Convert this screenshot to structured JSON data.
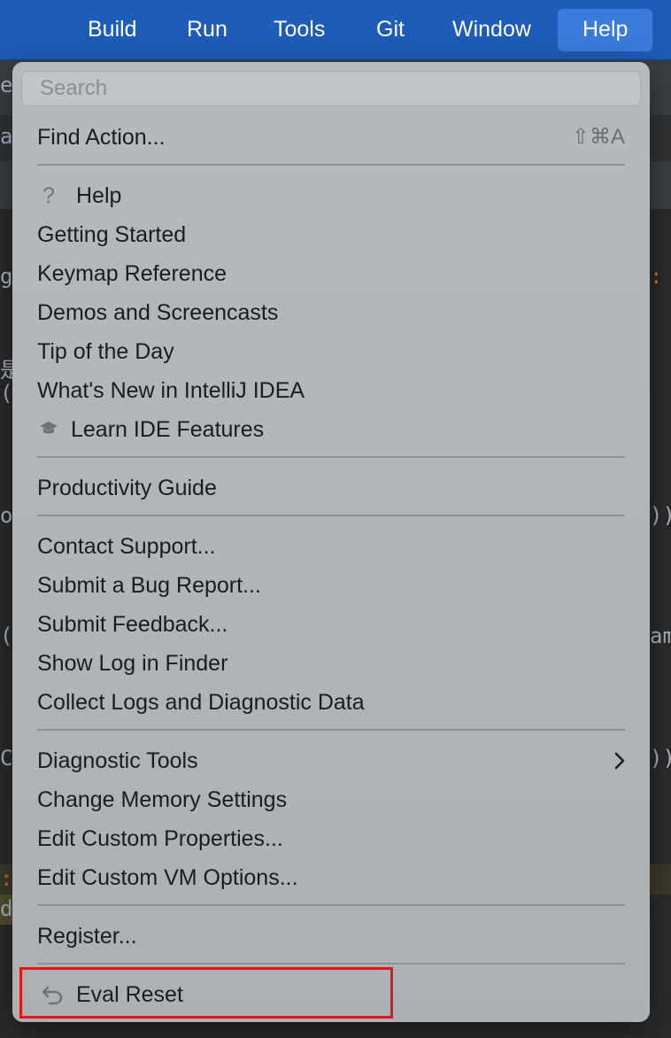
{
  "menubar": {
    "items": [
      "Build",
      "Run",
      "Tools",
      "Git",
      "Window",
      "Help"
    ],
    "active": "Help"
  },
  "background_code": {
    "fragments": [
      "ea",
      "a",
      "ge",
      ":",
      "是",
      "()",
      "or",
      "))",
      "(D",
      "am",
      "Co",
      "))",
      ":",
      "du"
    ]
  },
  "help_menu": {
    "search_placeholder": "Search",
    "find_action": {
      "label": "Find Action...",
      "shortcut": "⇧⌘A"
    },
    "help": "Help",
    "getting_started": "Getting Started",
    "keymap_reference": "Keymap Reference",
    "demos": "Demos and Screencasts",
    "tip_of_day": "Tip of the Day",
    "whats_new": "What's New in IntelliJ IDEA",
    "learn_ide": "Learn IDE Features",
    "productivity_guide": "Productivity Guide",
    "contact_support": "Contact Support...",
    "submit_bug": "Submit a Bug Report...",
    "submit_feedback": "Submit Feedback...",
    "show_log": "Show Log in Finder",
    "collect_logs": "Collect Logs and Diagnostic Data",
    "diagnostic_tools": "Diagnostic Tools",
    "change_memory": "Change Memory Settings",
    "edit_properties": "Edit Custom Properties...",
    "edit_vm_options": "Edit Custom VM Options...",
    "register": "Register...",
    "eval_reset": "Eval Reset",
    "icons": {
      "help": "question-mark",
      "learn": "graduation-cap",
      "submenu": "chevron-right",
      "eval_reset": "undo-arrow"
    }
  },
  "colors": {
    "menubar": "#1d5cb8",
    "menubar_active": "#3a7bdc",
    "menu_bg": "#b2b6b9",
    "highlight_box": "#e5141b"
  }
}
